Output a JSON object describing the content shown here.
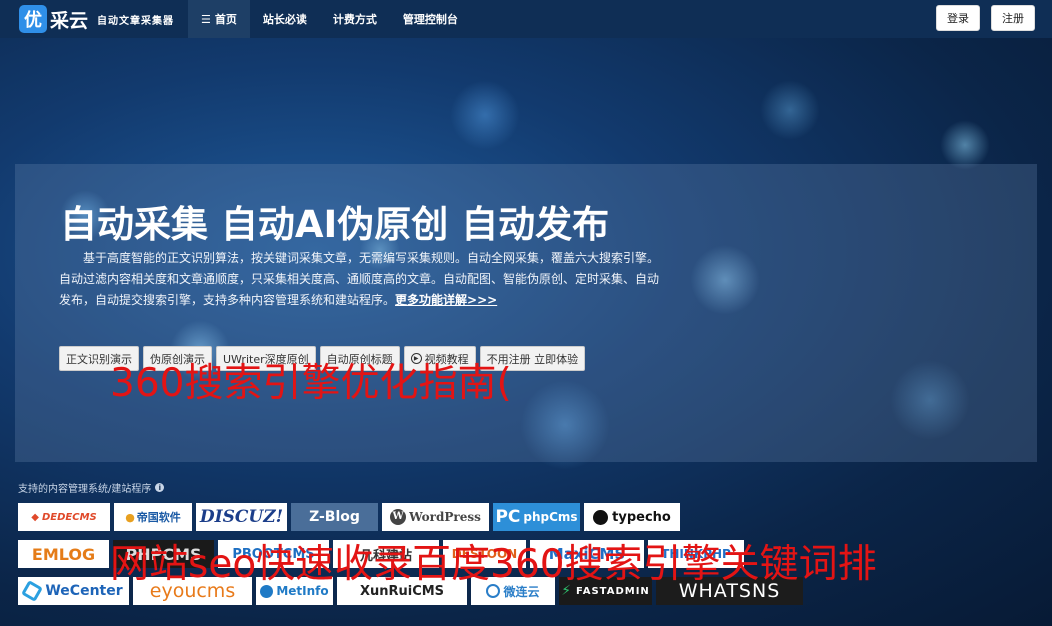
{
  "brand": {
    "logo_char": "优",
    "name": "采云",
    "subtitle": "自动文章采集器"
  },
  "nav": {
    "items": [
      {
        "label": "首页",
        "active": true
      },
      {
        "label": "站长必读"
      },
      {
        "label": "计费方式"
      },
      {
        "label": "管理控制台"
      }
    ],
    "login": "登录",
    "register": "注册"
  },
  "hero": {
    "title": "自动采集 自动AI伪原创 自动发布",
    "description": "基于高度智能的正文识别算法，按关键词采集文章，无需编写采集规则。自动全网采集，覆盖六大搜索引擎。自动过滤内容相关度和文章通顺度，只采集相关度高、通顺度高的文章。自动配图、智能伪原创、定时采集、自动发布，自动提交搜索引擎，支持多种内容管理系统和建站程序。",
    "more_link": "更多功能详解>>>",
    "buttons": [
      "正文识别演示",
      "伪原创演示",
      "UWriter深度原创",
      "自动原创标题",
      "视频教程",
      "不用注册 立即体验"
    ]
  },
  "overlays": {
    "line1": "360搜索引擎优化指南(",
    "line2": "网站seo快速收录百度360搜索引擎关键词排"
  },
  "cms": {
    "label": "支持的内容管理系统/建站程序",
    "row1": [
      "DEDECMS",
      "帝国软件",
      "DISCUZ!",
      "Z-Blog",
      "WordPress",
      "phpCms",
      "typecho"
    ],
    "row2": [
      "EMLOG",
      "PHPCMS",
      "PBOOTCMS",
      "凡科建站",
      "DESTOON",
      "MaxiCMS",
      "THINKPHP"
    ],
    "row3": [
      "WeCenter",
      "eyoucms",
      "MetInfo",
      "XunRuiCMS",
      "微连云",
      "FASTADMIN",
      "WHATSNS"
    ]
  },
  "colors": {
    "nav_bg": "#0f2e55",
    "accent": "#2f8fe8",
    "overlay_text": "#e31414"
  }
}
